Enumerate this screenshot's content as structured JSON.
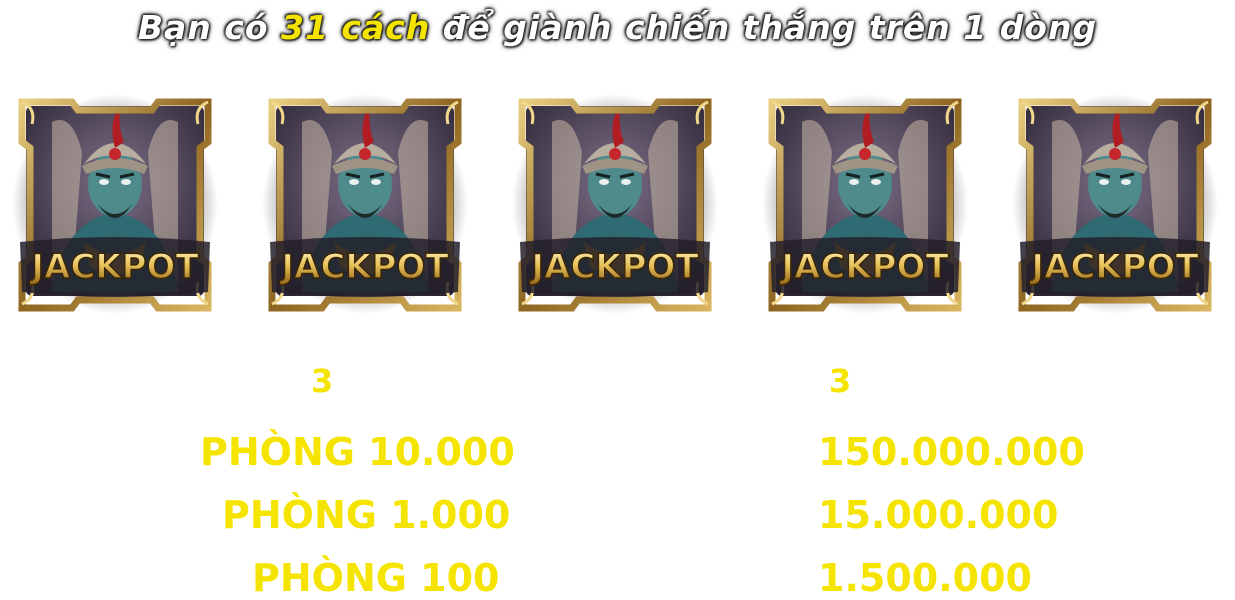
{
  "headline": {
    "prefix": "Bạn có ",
    "highlight": "31 cách",
    "suffix": " để giành chiến thắng trên 1 dòng"
  },
  "symbols": [
    {
      "label": "JACKPOT",
      "icon": "genie-jackpot-icon"
    },
    {
      "label": "JACKPOT",
      "icon": "genie-jackpot-icon"
    },
    {
      "label": "JACKPOT",
      "icon": "genie-jackpot-icon"
    },
    {
      "label": "JACKPOT",
      "icon": "genie-jackpot-icon"
    },
    {
      "label": "JACKPOT",
      "icon": "genie-jackpot-icon"
    }
  ],
  "payout_table": {
    "left_count": "3",
    "right_count": "3",
    "rows": [
      {
        "room": "PHÒNG 10.000",
        "prize": "150.000.000"
      },
      {
        "room": "PHÒNG 1.000",
        "prize": "15.000.000"
      },
      {
        "room": "PHÒNG 100",
        "prize": "1.500.000"
      }
    ]
  },
  "colors": {
    "highlight": "#f5e400",
    "frame_gold": "#c9a24a",
    "genie_skin": "#4f8a8c"
  }
}
